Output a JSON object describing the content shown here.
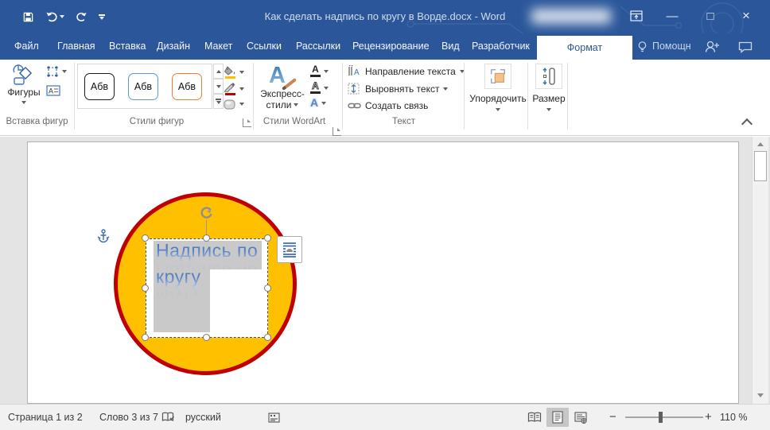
{
  "window": {
    "title": "Как сделать надпись по кругу в Ворде.docx - Word",
    "controls": {
      "minimize": "—",
      "maximize": "□",
      "close": "×"
    }
  },
  "tabs": [
    {
      "label": "Файл"
    },
    {
      "label": "Главная"
    },
    {
      "label": "Вставка"
    },
    {
      "label": "Дизайн"
    },
    {
      "label": "Макет"
    },
    {
      "label": "Ссылки"
    },
    {
      "label": "Рассылки"
    },
    {
      "label": "Рецензирование"
    },
    {
      "label": "Вид"
    },
    {
      "label": "Разработчик"
    },
    {
      "label": "Формат",
      "active": true
    }
  ],
  "help": {
    "label": "Помощн"
  },
  "ribbon": {
    "insert_shapes": {
      "group_label": "Вставка фигур",
      "shapes_button": "Фигуры"
    },
    "shape_styles": {
      "group_label": "Стили фигур",
      "thumbnails": [
        "Абв",
        "Абв",
        "Абв"
      ],
      "thumb_border_colors": [
        "#1a1a1a",
        "#5b9bd5",
        "#ed7d31"
      ],
      "fill_bar_color": "#FFC000",
      "outline_bar_color": "#C00000"
    },
    "wordart_styles": {
      "group_label": "Стили WordArt",
      "quick_styles_line1": "Экспресс-",
      "quick_styles_line2": "стили",
      "fill_icon_letter": "А",
      "outline_icon_letter": "А",
      "effects_icon_letter": "А",
      "quick_icon_letter": "А"
    },
    "text_group": {
      "group_label": "Текст",
      "items": [
        "Направление текста",
        "Выровнять текст",
        "Создать связь"
      ]
    },
    "arrange": {
      "button_label": "Упорядочить"
    },
    "size": {
      "button_label": "Размер"
    }
  },
  "document": {
    "wordart": {
      "line1": "Надпись по",
      "line2": "кругу"
    },
    "circle_fill_color": "#FFC000",
    "circle_border_color": "#C00000"
  },
  "status_bar": {
    "page": "Страница 1 из 2",
    "words": "Слово 3 из 7",
    "language": "русский",
    "zoom_minus": "−",
    "zoom_plus": "+",
    "zoom_level": "110 %"
  },
  "colors": {
    "titlebar": "#2b579a",
    "active_tab_text": "#2b579a",
    "wordart_blue": "#3f6db3"
  }
}
